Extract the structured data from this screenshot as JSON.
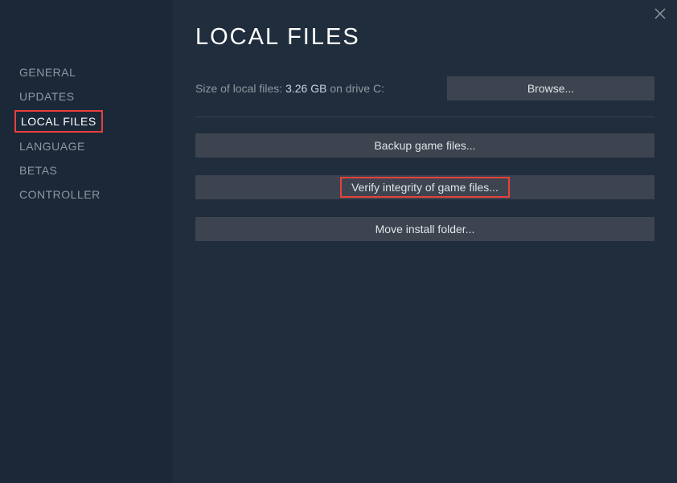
{
  "sidebar": {
    "items": [
      {
        "label": "GENERAL",
        "selected": false
      },
      {
        "label": "UPDATES",
        "selected": false
      },
      {
        "label": "LOCAL FILES",
        "selected": true
      },
      {
        "label": "LANGUAGE",
        "selected": false
      },
      {
        "label": "BETAS",
        "selected": false
      },
      {
        "label": "CONTROLLER",
        "selected": false
      }
    ]
  },
  "main": {
    "title": "LOCAL FILES",
    "size_label": "Size of local files: ",
    "size_value": "3.26 GB",
    "drive_label": " on drive C:",
    "browse_label": "Browse...",
    "backup_label": "Backup game files...",
    "verify_label": "Verify integrity of game files...",
    "move_label": "Move install folder..."
  }
}
